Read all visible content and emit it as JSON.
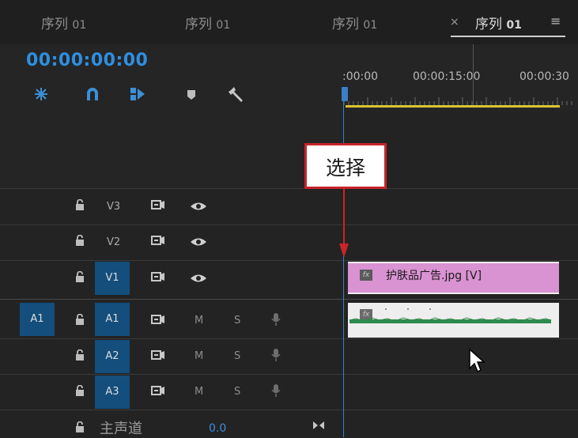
{
  "tabs": [
    {
      "label": "序列",
      "num": "01"
    },
    {
      "label": "序列",
      "num": "01"
    },
    {
      "label": "序列",
      "num": "01"
    },
    {
      "label": "序列",
      "num": "01",
      "active": true
    }
  ],
  "tab_close": "×",
  "tab_menu": "≡",
  "timecode": "00:00:00:00",
  "ruler": {
    "labels": [
      ":00:00",
      "00:00:15:00",
      "00:00:30"
    ]
  },
  "callout": "选择",
  "tracks": {
    "v3": "V3",
    "v2": "V2",
    "v1": "V1",
    "a1_source": "A1",
    "a1": "A1",
    "a2": "A2",
    "a3": "A3",
    "mute": "M",
    "solo": "S",
    "master_label": "主声道",
    "master_value": "0.0"
  },
  "clips": {
    "video_name": "护肤品广告.jpg [V]",
    "fx": "fx"
  },
  "colors": {
    "accent_blue": "#2e8fe0",
    "track_target": "#134e7c",
    "video_clip": "#d992d2",
    "audio_wave": "#2f8a4e",
    "work_area": "#d8c431",
    "callout_border": "#c8242a"
  }
}
